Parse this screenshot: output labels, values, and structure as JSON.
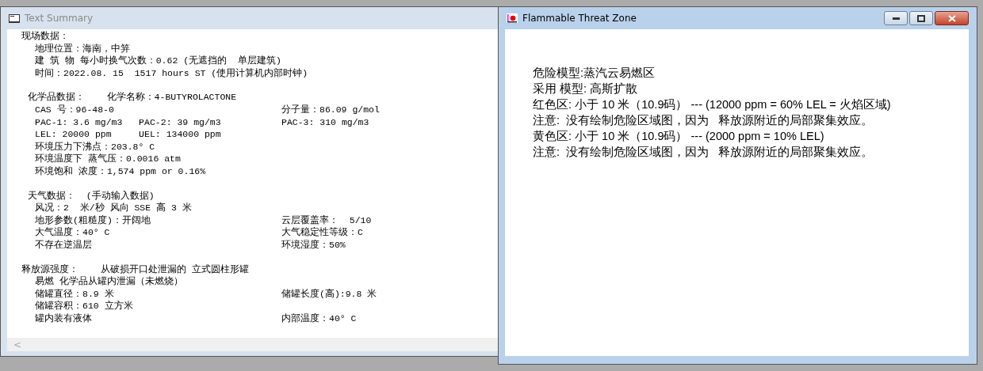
{
  "summary_window": {
    "title": "Text Summary",
    "active": false,
    "sections": [
      {
        "heading": "现场数据：",
        "lines": [
          {
            "text": "地理位置：海南，中笄"
          },
          {
            "text": "建 筑 物 每小时换气次数：0.62 (无遮挡的  单层建筑)"
          },
          {
            "text": "时间：2022.08. 15  1517 hours ST (使用计算机内部时钟)"
          }
        ]
      },
      {
        "heading": "化学品数据：    化学名称：4-BUTYROLACTONE",
        "lines": [
          {
            "text": "CAS 号：96-48-0",
            "right": "分子量：86.09 g/mol"
          },
          {
            "text": "PAC-1: 3.6 mg/m3   PAC-2: 39 mg/m3",
            "right": "PAC-3: 310 mg/m3"
          },
          {
            "text": "LEL: 20000 ppm     UEL: 134000 ppm"
          },
          {
            "text": "环境压力下沸点：203.8° C"
          },
          {
            "text": "环境温度下 蒸气压：0.0016 atm"
          },
          {
            "text": "环境饱和 浓度：1,574 ppm or 0.16%"
          }
        ]
      },
      {
        "heading": "天气数据：  (手动输入数据)",
        "lines": [
          {
            "text": "风况：2  米/秒 风向 SSE 高 3 米"
          },
          {
            "text": "地形参数(粗糙度)：开阔地",
            "right": "云层覆盖率：  5/10"
          },
          {
            "text": "大气温度：40° C",
            "right": "大气稳定性等级：C"
          },
          {
            "text": "不存在逆温层",
            "right": "环境湿度：50%"
          }
        ]
      },
      {
        "heading": "释放源强度：    从破损开口处泄漏的 立式圆柱形罐",
        "lines": [
          {
            "text": "易燃 化学品从罐内泄漏（未燃烧）"
          },
          {
            "text": "储罐直径：8.9 米",
            "right": "储罐长度(高):9.8 米"
          },
          {
            "text": "储罐容积：610 立方米"
          },
          {
            "text": "罐内装有液体",
            "right": "内部温度：40° C"
          }
        ]
      }
    ],
    "scroll_left": "<"
  },
  "threat_window": {
    "title": "Flammable Threat Zone",
    "active": true,
    "lines": [
      "危险模型:蒸汽云易燃区",
      "采用 模型: 高斯扩散",
      "红色区: 小于 10 米（10.9码） --- (12000 ppm = 60% LEL = 火焰区域)",
      "注意:  没有绘制危险区域图，因为   释放源附近的局部聚集效应。",
      "黄色区: 小于 10 米（10.9码） --- (2000 ppm = 10% LEL)",
      "注意:  没有绘制危险区域图，因为   释放源附近的局部聚集效应。"
    ]
  }
}
